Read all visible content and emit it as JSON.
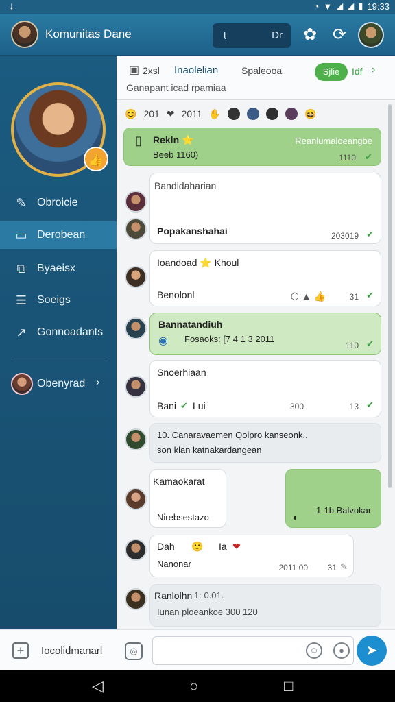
{
  "status_bar": {
    "time": "19:33"
  },
  "app_bar": {
    "title": "Komunitas Dane",
    "search_text": "Dr"
  },
  "sidebar": {
    "items": [
      {
        "label": "Obroicie",
        "icon": "edit-icon"
      },
      {
        "label": "Derobean",
        "icon": "inbox-icon"
      },
      {
        "label": "Byaeisx",
        "icon": "chart-icon"
      },
      {
        "label": "Soeigs",
        "icon": "document-icon"
      },
      {
        "label": "Gonnoadants",
        "icon": "share-icon"
      }
    ],
    "user": {
      "label": "Obenyrad"
    }
  },
  "channel": {
    "count": "2xsl",
    "name": "Inaolelian",
    "subtitle": "Spaleooa",
    "pill": "Sjlie",
    "link": "Idf",
    "line2": "Ganapant  icad rpamiaa"
  },
  "reaction_bar": {
    "count1": "201",
    "count2": "2011"
  },
  "messages": [
    {
      "sender": "Rekln ⭐",
      "text": "Beeb 1160)",
      "right_text": "Reanlumaloeangbe",
      "time": "1110"
    },
    {
      "sender": "Bandidaharian",
      "text": "Popakanshahai",
      "time": "203019",
      "bold": true
    },
    {
      "sender": "Ioandoad ⭐ Khoul",
      "text": "Benolonl",
      "time": "31"
    },
    {
      "sender": "Bannatandiuh",
      "text": "Fosaoks: [7 4 1 3 2011",
      "time": "110"
    },
    {
      "sender": "Snoerhiaan",
      "text": "Bani",
      "extra": "Lui",
      "time": "300",
      "time2": "13"
    },
    {
      "sender": "10. Canaravaemen Qoipro kanseonk..",
      "text": "son klan katnakardangean"
    },
    {
      "sender": "Kamaokarat",
      "text": "Nirebsestazo",
      "right_text": "1-1b Balvokar"
    },
    {
      "sender": "Dah",
      "sender_suffix": "Ia",
      "text": "Nanonar",
      "time": "2011 00",
      "time2": "31"
    },
    {
      "sender": "Ranlolhn",
      "sender_suffix": "1: 0.01.",
      "text": "Iunan  ploeankoe 300 120"
    }
  ],
  "composer": {
    "label": "Iocolidmanarl"
  },
  "colors": {
    "accent": "#1d8fd0",
    "header": "#1f5f84",
    "green": "#9fd18b"
  }
}
